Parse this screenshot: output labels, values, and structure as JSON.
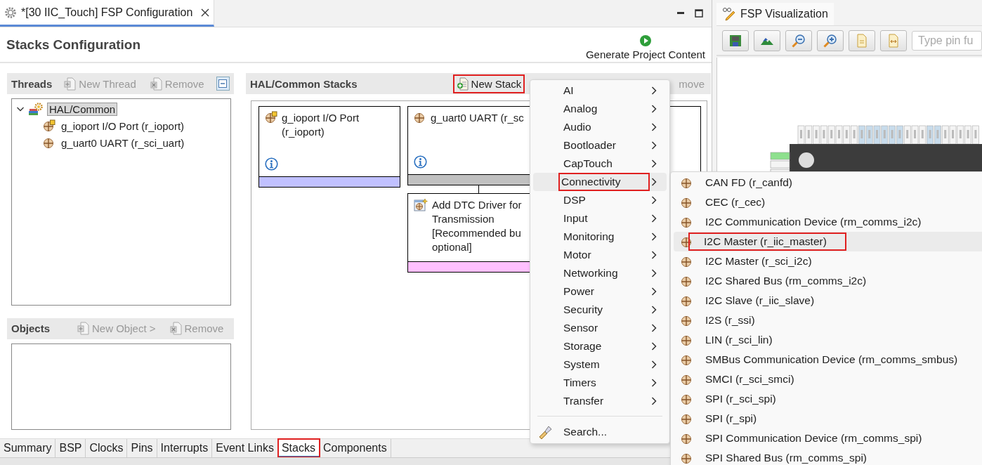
{
  "editor_tab": {
    "title": "*[30 IIC_Touch] FSP Configuration",
    "selected": true
  },
  "page_title": "Stacks Configuration",
  "generate_button": {
    "label": "Generate Project Content"
  },
  "threads": {
    "title": "Threads",
    "actions": [
      {
        "kind": "new",
        "label": "New Thread",
        "disabled": true
      },
      {
        "kind": "remove",
        "label": "Remove",
        "disabled": true
      }
    ],
    "tree": [
      {
        "label": "HAL/Common",
        "kind": "common",
        "expanded": true,
        "selected": true,
        "children": [
          {
            "label": "g_ioport I/O Port (r_ioport)",
            "kind": "port",
            "selected": false
          },
          {
            "label": "g_uart0 UART (r_sci_uart)",
            "kind": "module",
            "selected": false
          }
        ]
      }
    ]
  },
  "objects": {
    "title": "Objects",
    "actions": [
      {
        "kind": "new",
        "label": "New Object >",
        "disabled": true
      },
      {
        "kind": "remove",
        "label": "Remove",
        "disabled": true
      }
    ]
  },
  "stacks": {
    "title": "HAL/Common Stacks",
    "actions": [
      {
        "kind": "new_stack",
        "label": "New Stack",
        "disabled": false,
        "highlighted": true
      },
      {
        "kind": "covered",
        "label": "move",
        "disabled": true,
        "highlighted": false
      }
    ],
    "cards": [
      {
        "kind": "port",
        "text": "g_ioport I/O Port (r_ioport)",
        "info": true,
        "color": "#c0c0ff"
      },
      {
        "kind": "module",
        "text": "g_uart0 UART (r_sc",
        "info": true,
        "color": "#c0c0c0"
      },
      {
        "kind": "add",
        "text": "Add DTC Driver for\nTransmission\n[Recommended bu\noptional]",
        "info": false,
        "color": "#ffc0ff"
      }
    ]
  },
  "bottom_tabs": [
    {
      "label": "Summary",
      "selected": false,
      "highlighted": false
    },
    {
      "label": "BSP",
      "selected": false,
      "highlighted": false
    },
    {
      "label": "Clocks",
      "selected": false,
      "highlighted": false
    },
    {
      "label": "Pins",
      "selected": false,
      "highlighted": false
    },
    {
      "label": "Interrupts",
      "selected": false,
      "highlighted": false
    },
    {
      "label": "Event Links",
      "selected": false,
      "highlighted": false
    },
    {
      "label": "Stacks",
      "selected": true,
      "highlighted": true
    },
    {
      "label": "Components",
      "selected": false,
      "highlighted": false
    }
  ],
  "visualization": {
    "tab": {
      "title": "FSP Visualization",
      "selected": true
    },
    "search": {
      "placeholder": "Type pin fu"
    }
  },
  "menu": {
    "items": [
      {
        "label": "AI",
        "selected": false,
        "highlighted": false
      },
      {
        "label": "Analog",
        "selected": false,
        "highlighted": false
      },
      {
        "label": "Audio",
        "selected": false,
        "highlighted": false
      },
      {
        "label": "Bootloader",
        "selected": false,
        "highlighted": false
      },
      {
        "label": "CapTouch",
        "selected": false,
        "highlighted": false
      },
      {
        "label": "Connectivity",
        "selected": true,
        "highlighted": true
      },
      {
        "label": "DSP",
        "selected": false,
        "highlighted": false
      },
      {
        "label": "Input",
        "selected": false,
        "highlighted": false
      },
      {
        "label": "Monitoring",
        "selected": false,
        "highlighted": false
      },
      {
        "label": "Motor",
        "selected": false,
        "highlighted": false
      },
      {
        "label": "Networking",
        "selected": false,
        "highlighted": false
      },
      {
        "label": "Power",
        "selected": false,
        "highlighted": false
      },
      {
        "label": "Security",
        "selected": false,
        "highlighted": false
      },
      {
        "label": "Sensor",
        "selected": false,
        "highlighted": false
      },
      {
        "label": "Storage",
        "selected": false,
        "highlighted": false
      },
      {
        "label": "System",
        "selected": false,
        "highlighted": false
      },
      {
        "label": "Timers",
        "selected": false,
        "highlighted": false
      },
      {
        "label": "Transfer",
        "selected": false,
        "highlighted": false
      }
    ],
    "search": {
      "label": "Search..."
    }
  },
  "submenu": {
    "items": [
      {
        "label": "CAN FD (r_canfd)",
        "selected": false,
        "highlighted": false
      },
      {
        "label": "CEC (r_cec)",
        "selected": false,
        "highlighted": false
      },
      {
        "label": "I2C Communication Device (rm_comms_i2c)",
        "selected": false,
        "highlighted": false
      },
      {
        "label": "I2C Master (r_iic_master)",
        "selected": true,
        "highlighted": true
      },
      {
        "label": "I2C Master (r_sci_i2c)",
        "selected": false,
        "highlighted": false
      },
      {
        "label": "I2C Shared Bus (rm_comms_i2c)",
        "selected": false,
        "highlighted": false
      },
      {
        "label": "I2C Slave (r_iic_slave)",
        "selected": false,
        "highlighted": false
      },
      {
        "label": "I2S (r_ssi)",
        "selected": false,
        "highlighted": false
      },
      {
        "label": "LIN (r_sci_lin)",
        "selected": false,
        "highlighted": false
      },
      {
        "label": "SMBus Communication Device (rm_comms_smbus)",
        "selected": false,
        "highlighted": false
      },
      {
        "label": "SMCI (r_sci_smci)",
        "selected": false,
        "highlighted": false
      },
      {
        "label": "SPI (r_sci_spi)",
        "selected": false,
        "highlighted": false
      },
      {
        "label": "SPI (r_spi)",
        "selected": false,
        "highlighted": false
      },
      {
        "label": "SPI Communication Device (rm_comms_spi)",
        "selected": false,
        "highlighted": false
      },
      {
        "label": "SPI Shared Bus (rm_comms_spi)",
        "selected": false,
        "highlighted": false
      }
    ]
  }
}
